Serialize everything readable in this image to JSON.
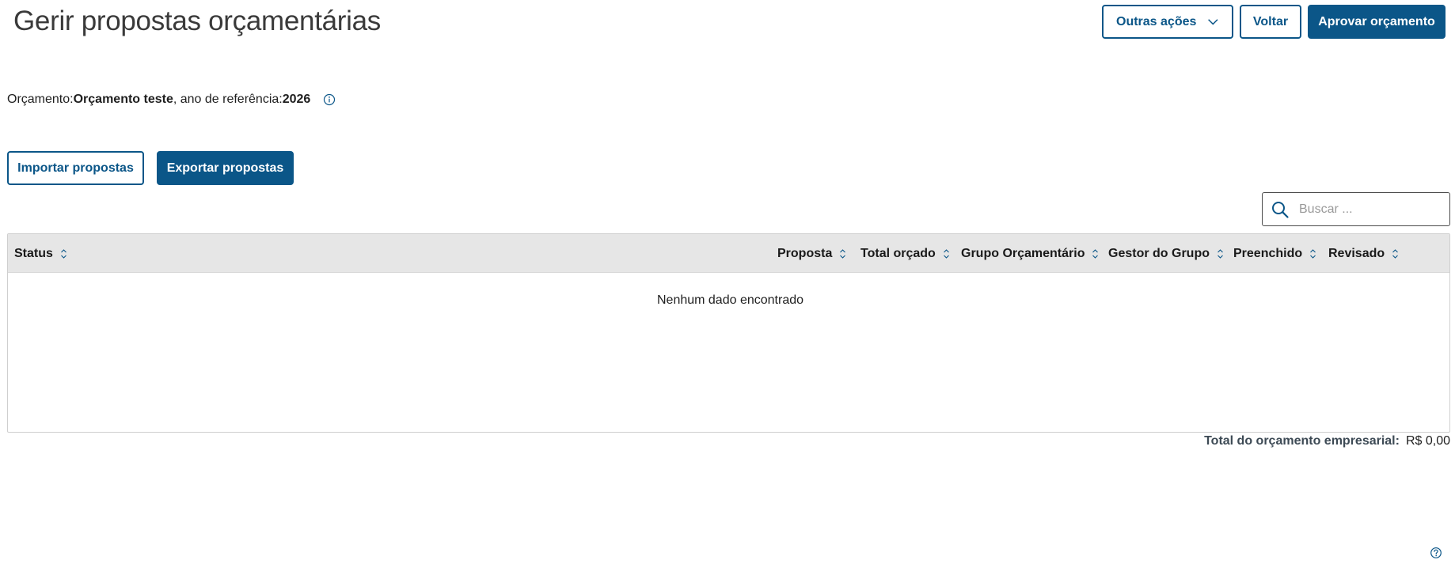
{
  "page": {
    "title": "Gerir propostas orçamentárias"
  },
  "header_actions": {
    "more_actions_label": "Outras ações",
    "back_label": "Voltar",
    "approve_label": "Aprovar orçamento"
  },
  "budget_info": {
    "budget_prefix": "Orçamento: ",
    "budget_name": "Orçamento teste",
    "year_prefix": ", ano de referência: ",
    "year": "2026",
    "info_icon": "info-icon"
  },
  "io_actions": {
    "import_label": "Importar propostas",
    "export_label": "Exportar propostas"
  },
  "search": {
    "placeholder": "Buscar ...",
    "value": "",
    "icon": "search-icon"
  },
  "table": {
    "columns": [
      {
        "label": "Status"
      },
      {
        "label": "Proposta"
      },
      {
        "label": "Total orçado"
      },
      {
        "label": "Grupo Orçamentário"
      },
      {
        "label": "Gestor do Grupo"
      },
      {
        "label": "Preenchido"
      },
      {
        "label": "Revisado"
      }
    ],
    "rows": [],
    "empty_message": "Nenhum dado encontrado"
  },
  "footer": {
    "total_label": "Total do orçamento empresarial:",
    "total_value": "R$ 0,00",
    "help_icon": "help-icon"
  },
  "colors": {
    "primary": "#0b5688",
    "header_bg": "#e6e6e6",
    "title_text": "#3a3a3a"
  }
}
